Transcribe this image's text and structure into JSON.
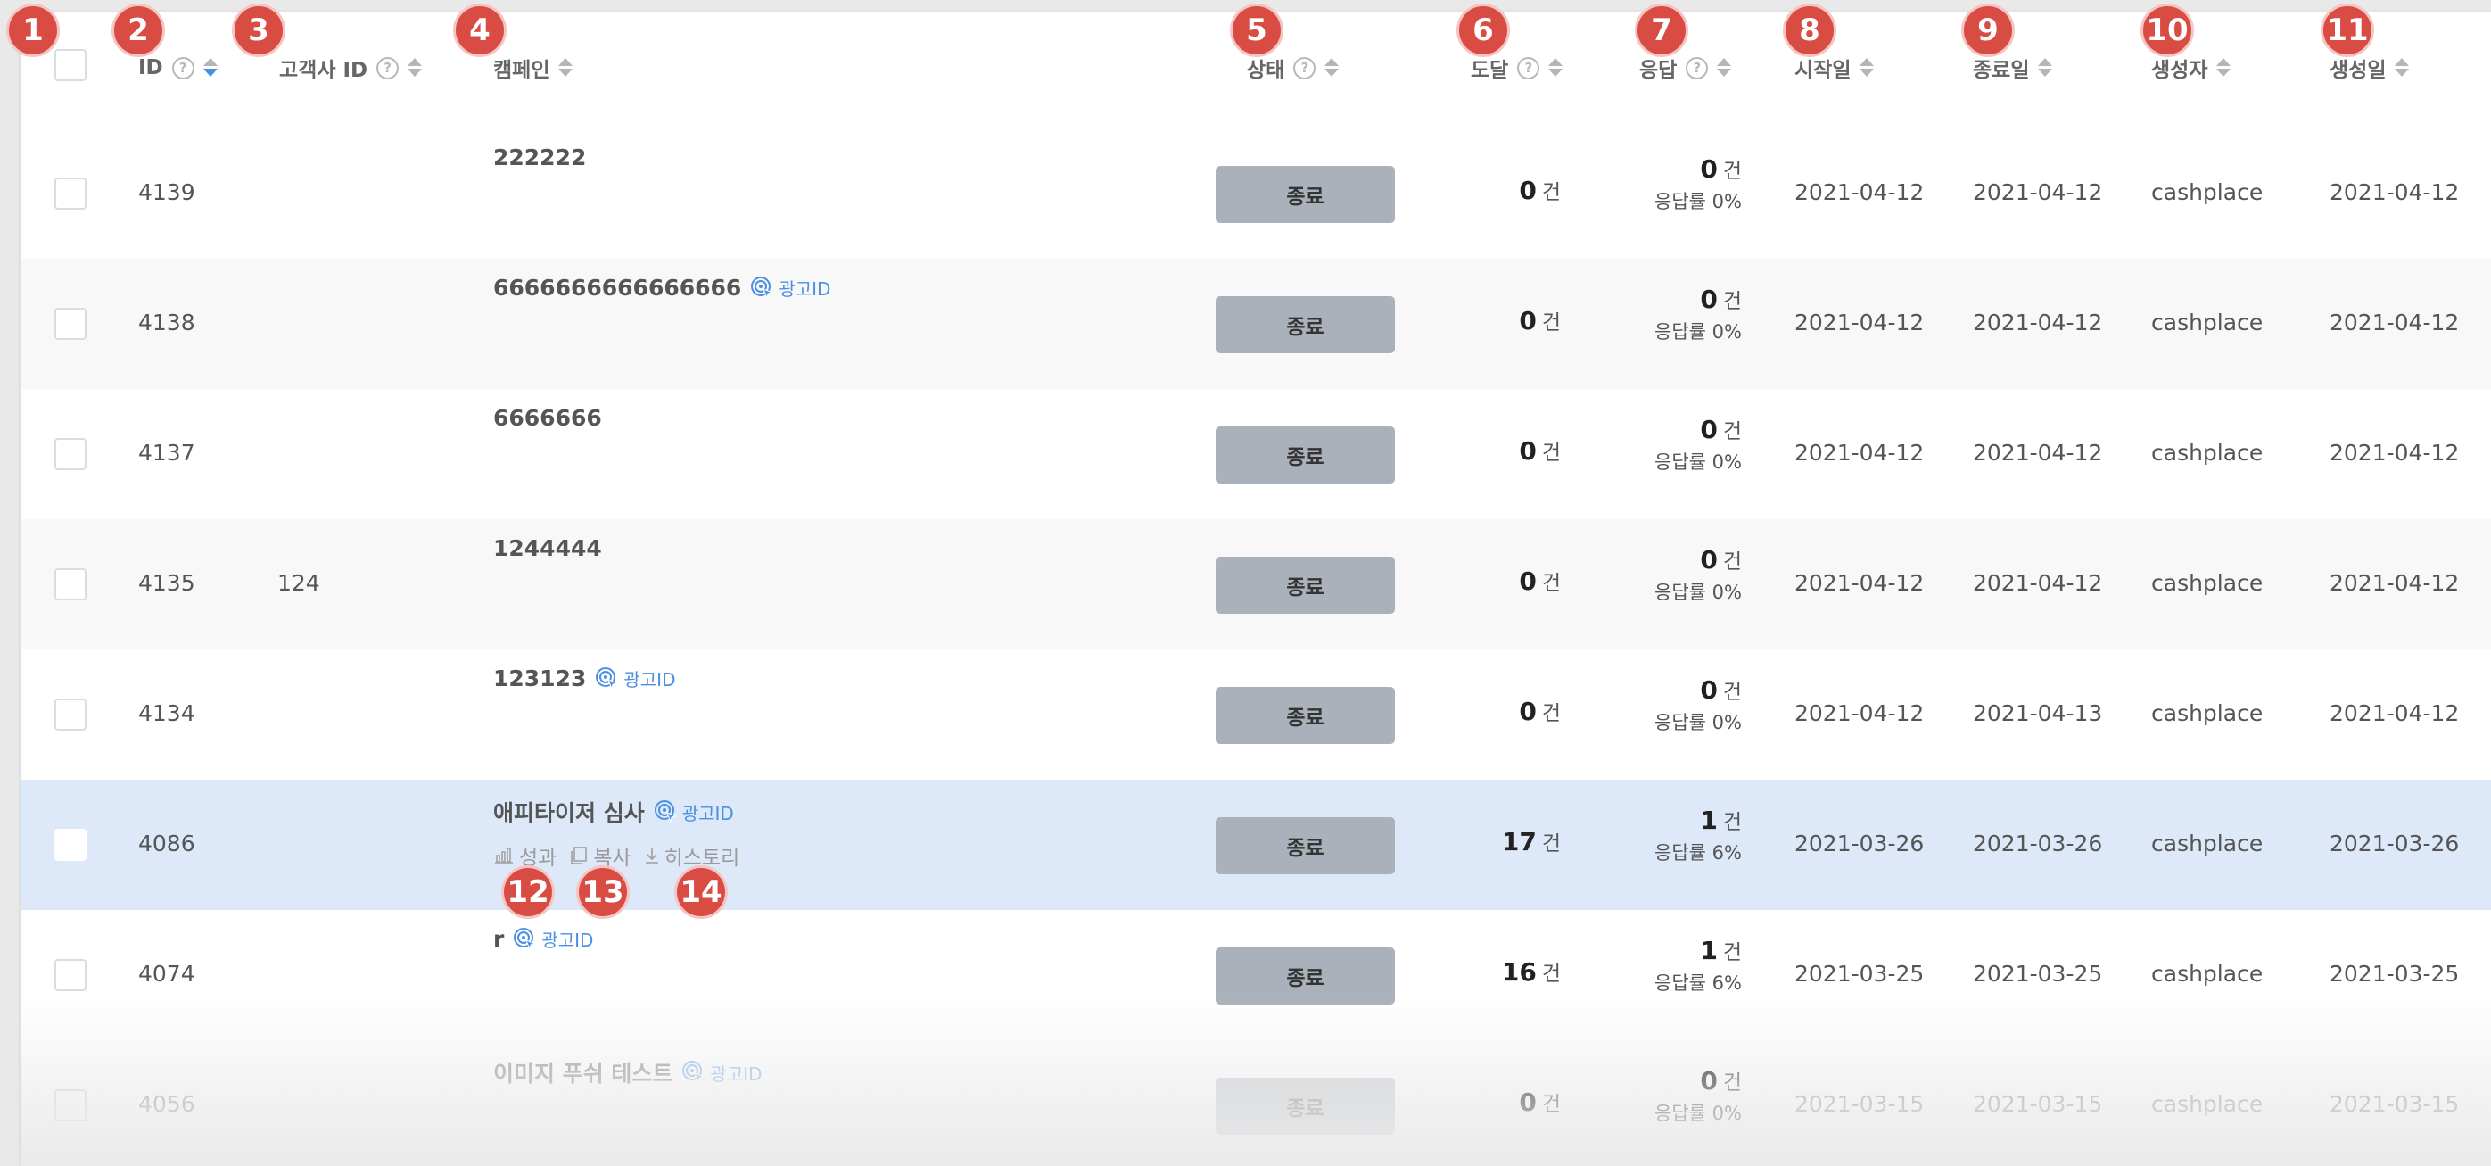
{
  "headers": {
    "id": "ID",
    "client_id": "고객사 ID",
    "campaign": "캠페인",
    "status": "상태",
    "reach": "도달",
    "response": "응답",
    "start": "시작일",
    "end": "종료일",
    "creator": "생성자",
    "created": "생성일",
    "help_glyph": "?"
  },
  "labels": {
    "ad_id": "광고ID",
    "status_ended": "종료",
    "unit": "건",
    "response_rate_prefix": "응답률 ",
    "action_performance": "성과",
    "action_copy": "복사",
    "action_history": "히스토리"
  },
  "sort": {
    "active_column": "id",
    "active_direction": "descending",
    "active_color": "#4a90e2"
  },
  "colors": {
    "highlight_row": "#dde8f8",
    "status_button": "#aab1ba",
    "badge": "#d94c44",
    "link": "#4a90e2"
  },
  "rows": [
    {
      "id": "4139",
      "client_id": "",
      "campaign": "222222",
      "ad_id": false,
      "status": "종료",
      "reach": "0",
      "response": "0",
      "response_rate": "0%",
      "start": "2021-04-12",
      "end": "2021-04-12",
      "creator": "cashplace",
      "created": "2021-04-12",
      "style": "normal"
    },
    {
      "id": "4138",
      "client_id": "",
      "campaign": "6666666666666666",
      "ad_id": true,
      "status": "종료",
      "reach": "0",
      "response": "0",
      "response_rate": "0%",
      "start": "2021-04-12",
      "end": "2021-04-12",
      "creator": "cashplace",
      "created": "2021-04-12",
      "style": "alt"
    },
    {
      "id": "4137",
      "client_id": "",
      "campaign": "6666666",
      "ad_id": false,
      "status": "종료",
      "reach": "0",
      "response": "0",
      "response_rate": "0%",
      "start": "2021-04-12",
      "end": "2021-04-12",
      "creator": "cashplace",
      "created": "2021-04-12",
      "style": "normal"
    },
    {
      "id": "4135",
      "client_id": "124",
      "campaign": "1244444",
      "ad_id": false,
      "status": "종료",
      "reach": "0",
      "response": "0",
      "response_rate": "0%",
      "start": "2021-04-12",
      "end": "2021-04-12",
      "creator": "cashplace",
      "created": "2021-04-12",
      "style": "alt"
    },
    {
      "id": "4134",
      "client_id": "",
      "campaign": "123123",
      "ad_id": true,
      "status": "종료",
      "reach": "0",
      "response": "0",
      "response_rate": "0%",
      "start": "2021-04-12",
      "end": "2021-04-13",
      "creator": "cashplace",
      "created": "2021-04-12",
      "style": "normal"
    },
    {
      "id": "4086",
      "client_id": "",
      "campaign": "애피타이저 심사",
      "ad_id": true,
      "status": "종료",
      "reach": "17",
      "response": "1",
      "response_rate": "6%",
      "start": "2021-03-26",
      "end": "2021-03-26",
      "creator": "cashplace",
      "created": "2021-03-26",
      "style": "highlight",
      "actions": true
    },
    {
      "id": "4074",
      "client_id": "",
      "campaign": "r",
      "ad_id": true,
      "status": "종료",
      "reach": "16",
      "response": "1",
      "response_rate": "6%",
      "start": "2021-03-25",
      "end": "2021-03-25",
      "creator": "cashplace",
      "created": "2021-03-25",
      "style": "normal"
    },
    {
      "id": "4056",
      "client_id": "",
      "campaign": "이미지 푸쉬 테스트",
      "ad_id": true,
      "status": "종료",
      "reach": "0",
      "response": "0",
      "response_rate": "0%",
      "start": "2021-03-15",
      "end": "2021-03-15",
      "creator": "cashplace",
      "created": "2021-03-15",
      "style": "dim"
    }
  ],
  "annotations": [
    "1",
    "2",
    "3",
    "4",
    "5",
    "6",
    "7",
    "8",
    "9",
    "10",
    "11",
    "12",
    "13",
    "14"
  ]
}
